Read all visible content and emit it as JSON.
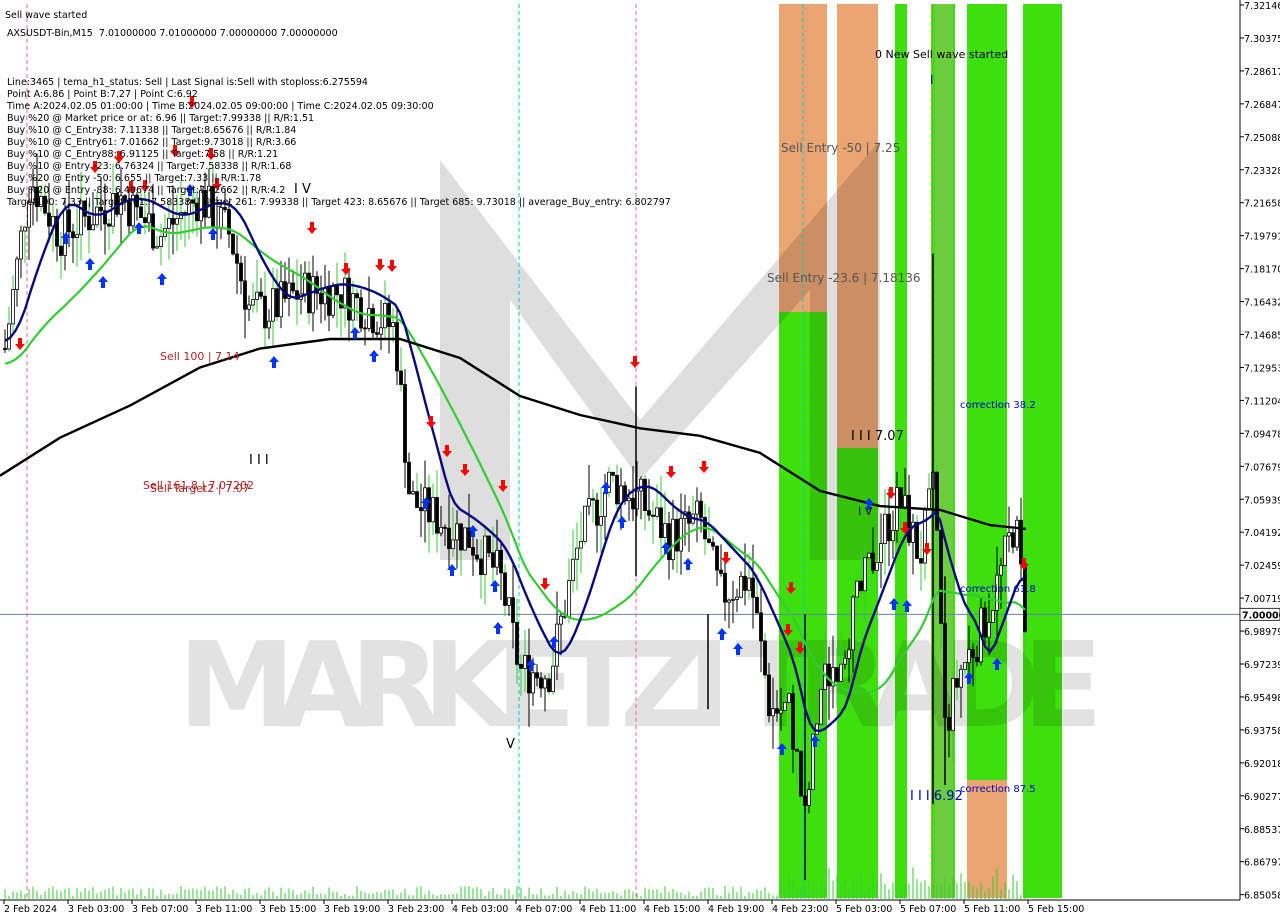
{
  "chart_data": {
    "type": "candlestick",
    "symbol_line": "AXSUSDT-Bin,M15  7.01000000 7.01000000 7.00000000 7.00000000",
    "info_lines": [
      "Line:3465 | tema_h1_status: Sell | Last Signal is:Sell with stoploss:6.275594",
      "Point A:6.86 | Point B:7.27 | Point C:6.92",
      "Time A:2024.02.05 01:00:00 | Time B:2024.02.05 09:00:00 | Time C:2024.02.05 09:30:00",
      "Buy %20 @ Market price or at: 6.96 || Target:7.99338 || R/R:1.51",
      "Buy %10 @ C_Entry38: 7.11338 || Target:8.65676 || R/R:1.84",
      "Buy %10 @ C_Entry61: 7.01662 || Target:9.73018 || R/R:3.66",
      "Buy %10 @ C_Entry88: 6.91125 || Target:7.58 || R/R:1.21",
      "Buy %10 @ Entry -23: 6.76324 || Target:7.58338 || R/R:1.68",
      "Buy %20 @ Entry -50: 6.655 || Target:7.33 || R/R:1.78",
      "Buy %20 @ Entry -88: 6.49674 || Target:7.42662 || R/R:4.2",
      "Target100: 7.33 || Target 161: 7.58338 || Target 261: 7.99338 || Target 423: 8.65676 || Target 685: 9.73018 || average_Buy_entry: 6.802797"
    ],
    "sell_wave_label": "Sell wave started",
    "y_ticks": [
      "7.32146",
      "7.30375",
      "7.28617",
      "7.26847",
      "7.25088",
      "7.23328",
      "7.21658",
      "7.19791",
      "7.18170",
      "7.16432",
      "7.14685",
      "7.12953",
      "7.11204",
      "7.09478",
      "7.07679",
      "7.05939",
      "7.04192",
      "7.02459",
      "7.00719",
      "6.98979",
      "6.97239",
      "6.95498",
      "6.93758",
      "6.92018",
      "6.90277",
      "6.88537",
      "6.86797",
      "6.85058"
    ],
    "current_price": "7.00000",
    "x_ticks": [
      "2 Feb 2024",
      "3 Feb 03:00",
      "3 Feb 07:00",
      "3 Feb 11:00",
      "3 Feb 15:00",
      "3 Feb 19:00",
      "3 Feb 23:00",
      "4 Feb 03:00",
      "4 Feb 07:00",
      "4 Feb 11:00",
      "4 Feb 15:00",
      "4 Feb 19:00",
      "4 Feb 23:00",
      "5 Feb 03:00",
      "5 Feb 07:00",
      "5 Feb 11:00",
      "5 Feb 15:00"
    ],
    "annotations": [
      {
        "text": "Sell 100 | 7.14",
        "color": "#b22222"
      },
      {
        "text": "Sell 161.8 | 7.07202",
        "color": "#b22222"
      },
      {
        "text": "Sell Target2 | 7.07",
        "color": "#b22222"
      },
      {
        "text": "Sell Entry -50 | 7.25",
        "color": "#555555"
      },
      {
        "text": "Sell Entry -23.6 | 7.18136",
        "color": "#555555"
      },
      {
        "text": "0 New Sell wave started",
        "color": "#000000"
      },
      {
        "text": "correction 38.2",
        "color": "#0000cc"
      },
      {
        "text": "correction 61.8",
        "color": "#0000cc"
      },
      {
        "text": "correction 87.5",
        "color": "#0000cc"
      },
      {
        "text": "I I I 7.07",
        "color": "#000000"
      },
      {
        "text": "I I I 6.92",
        "color": "#0000cc"
      },
      {
        "text": "I V",
        "color": "#000000"
      },
      {
        "text": "I I I",
        "color": "#000000"
      },
      {
        "text": "V",
        "color": "#000000"
      },
      {
        "text": "I V",
        "color": "#000000"
      },
      {
        "text": "I",
        "color": "#0000cc"
      }
    ],
    "watermark": "MARKETZI TRADE",
    "colors": {
      "candle": "#000000",
      "wick_green": "#33cc33",
      "ma_navy": "#0a0a80",
      "ma_green": "#33cc33",
      "ma_black": "#000000",
      "band_green": "#33dd00",
      "band_orange": "#e8955a",
      "buy_arrow": "#0033ff",
      "sell_arrow": "#ff0000",
      "price_line": "#6a7fb0"
    },
    "ylim": [
      6.85058,
      7.32146
    ]
  }
}
